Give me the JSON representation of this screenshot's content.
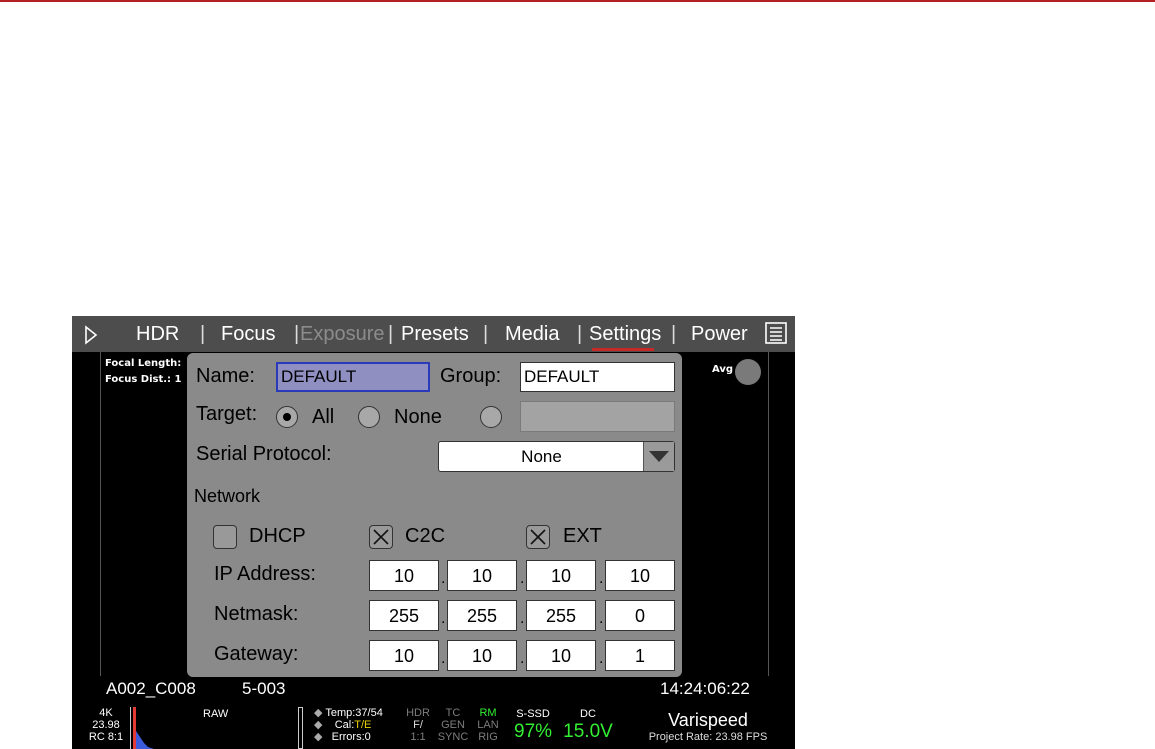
{
  "menu": {
    "items": [
      "HDR",
      "Focus",
      "Exposure",
      "Presets",
      "Media",
      "Settings",
      "Power"
    ],
    "active": "Settings",
    "disabled": "Exposure"
  },
  "viewport": {
    "focal_length": "Focal Length:",
    "focus_dist": "Focus Dist.: 1",
    "avg": "Avg"
  },
  "dialog": {
    "name_label": "Name:",
    "name_value": "DEFAULT",
    "group_label": "Group:",
    "group_value": "DEFAULT",
    "target_label": "Target:",
    "target_all": "All",
    "target_none": "None",
    "serial_label": "Serial Protocol:",
    "serial_value": "None",
    "network_label": "Network",
    "dhcp_label": "DHCP",
    "c2c_label": "C2C",
    "ext_label": "EXT",
    "ip_label": "IP Address:",
    "netmask_label": "Netmask:",
    "gateway_label": "Gateway:",
    "ip": [
      "10",
      "10",
      "10",
      "10"
    ],
    "netmask": [
      "255",
      "255",
      "255",
      "0"
    ],
    "gateway": [
      "10",
      "10",
      "10",
      "1"
    ],
    "dot": "."
  },
  "clip": {
    "name": "A002_C008",
    "reel": "5-003",
    "timecode": "14:24:06:22"
  },
  "status": {
    "res": "4K",
    "fps": "23.98",
    "rc": "RC 8:1",
    "raw": "RAW",
    "temp": "Temp:37/54",
    "cal_prefix": "Cal:",
    "cal_value": "T/E",
    "errors": "Errors:0",
    "hdr": "HDR",
    "f": "F/",
    "ratio": "1:1",
    "tc": "TC",
    "gen": "GEN",
    "sync": "SYNC",
    "rm": "RM",
    "lan": "LAN",
    "rig": "RIG",
    "ssd_label": "S-SSD",
    "ssd_value": "97%",
    "dc_label": "DC",
    "dc_value": "15.0V",
    "varispeed": "Varispeed",
    "project_rate": "Project Rate: 23.98 FPS"
  },
  "colors": {
    "accent_red": "#c62828",
    "status_green": "#33ee33",
    "dialog_bg": "#8a8a8a",
    "menubar_bg": "#4d4d4d"
  }
}
